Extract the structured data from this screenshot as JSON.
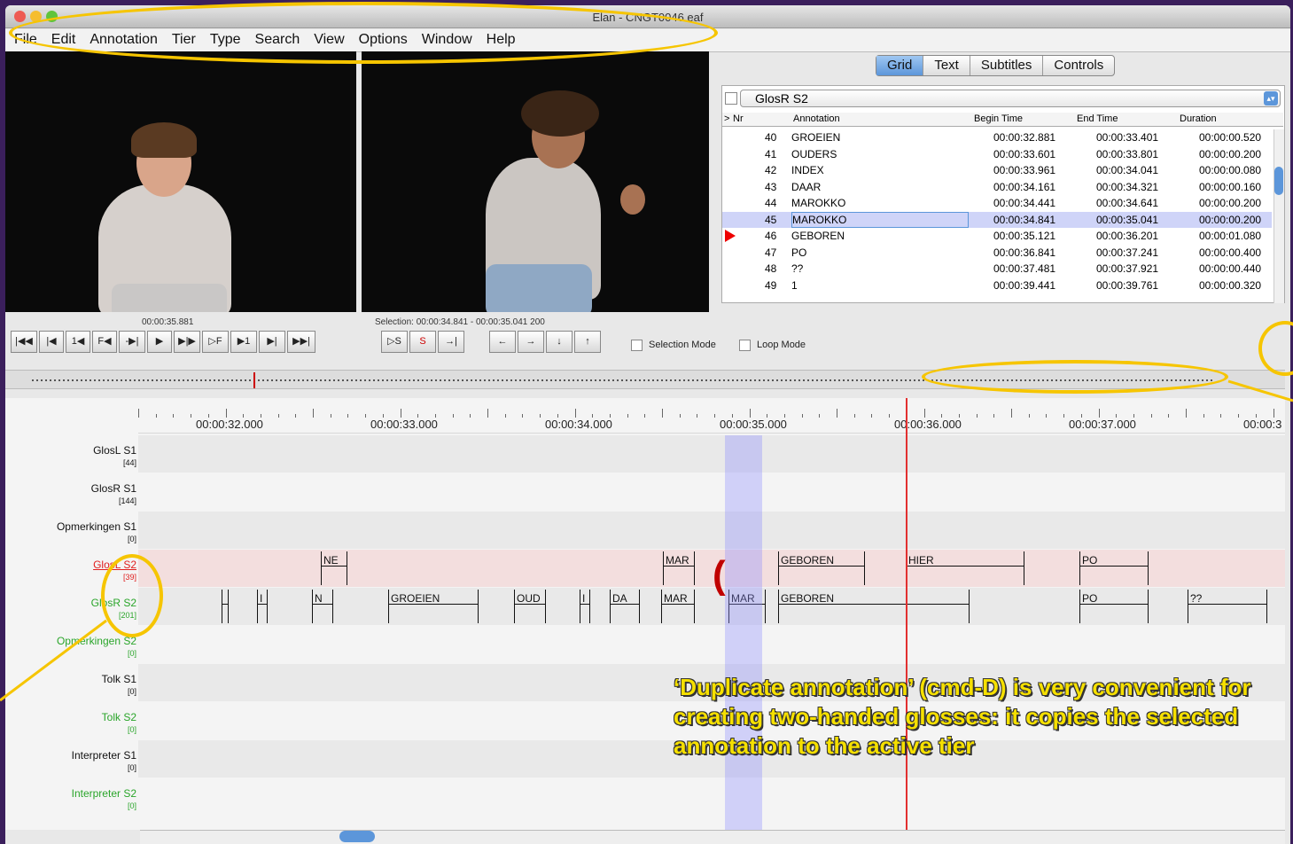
{
  "window": {
    "title": "Elan - CNGT0046.eaf"
  },
  "menu": [
    "File",
    "Edit",
    "Annotation",
    "Tier",
    "Type",
    "Search",
    "View",
    "Options",
    "Window",
    "Help"
  ],
  "media": {
    "time": "00:00:35.881",
    "selection": "Selection: 00:00:34.841 - 00:00:35.041  200"
  },
  "player_buttons": [
    "|◀◀",
    "|◀",
    "1◀",
    "F◀",
    "-▶|",
    "▶",
    "▶|▶",
    "▷F",
    "▶1",
    "▶|",
    "▶▶|"
  ],
  "selection_buttons": [
    "▷S",
    "S",
    "→|"
  ],
  "arrow_buttons": [
    "←",
    "→",
    "↓",
    "↑"
  ],
  "selection_mode": "Selection Mode",
  "loop_mode": "Loop Mode",
  "tabs": [
    "Grid",
    "Text",
    "Subtitles",
    "Controls"
  ],
  "tier_select": "GlosR S2",
  "grid_headers": {
    "pointer": ">",
    "nr": "Nr",
    "annotation": "Annotation",
    "begin": "Begin Time",
    "end": "End Time",
    "duration": "Duration"
  },
  "grid_rows": [
    {
      "nr": "40",
      "annotation": "GROEIEN",
      "begin": "00:00:32.881",
      "end": "00:00:33.401",
      "duration": "00:00:00.520"
    },
    {
      "nr": "41",
      "annotation": "OUDERS",
      "begin": "00:00:33.601",
      "end": "00:00:33.801",
      "duration": "00:00:00.200"
    },
    {
      "nr": "42",
      "annotation": "INDEX",
      "begin": "00:00:33.961",
      "end": "00:00:34.041",
      "duration": "00:00:00.080"
    },
    {
      "nr": "43",
      "annotation": "DAAR",
      "begin": "00:00:34.161",
      "end": "00:00:34.321",
      "duration": "00:00:00.160"
    },
    {
      "nr": "44",
      "annotation": "MAROKKO",
      "begin": "00:00:34.441",
      "end": "00:00:34.641",
      "duration": "00:00:00.200"
    },
    {
      "nr": "45",
      "annotation": "MAROKKO",
      "begin": "00:00:34.841",
      "end": "00:00:35.041",
      "duration": "00:00:00.200"
    },
    {
      "nr": "46",
      "annotation": "GEBOREN",
      "begin": "00:00:35.121",
      "end": "00:00:36.201",
      "duration": "00:00:01.080"
    },
    {
      "nr": "47",
      "annotation": "PO",
      "begin": "00:00:36.841",
      "end": "00:00:37.241",
      "duration": "00:00:00.400"
    },
    {
      "nr": "48",
      "annotation": "??",
      "begin": "00:00:37.481",
      "end": "00:00:37.921",
      "duration": "00:00:00.440"
    },
    {
      "nr": "49",
      "annotation": "1",
      "begin": "00:00:39.441",
      "end": "00:00:39.761",
      "duration": "00:00:00.320"
    }
  ],
  "ruler_labels": [
    "00:00:32.000",
    "00:00:33.000",
    "00:00:34.000",
    "00:00:35.000",
    "00:00:36.000",
    "00:00:37.000",
    "00:00:3"
  ],
  "tiers": [
    {
      "name": "GlosL S1",
      "count": "[44]",
      "color": "#111111"
    },
    {
      "name": "GlosR S1",
      "count": "[144]",
      "color": "#111111"
    },
    {
      "name": "Opmerkingen S1",
      "count": "[0]",
      "color": "#111111"
    },
    {
      "name": "GlosL S2",
      "count": "[39]",
      "color": "#e02020"
    },
    {
      "name": "GlosR S2",
      "count": "[201]",
      "color": "#2aa52a"
    },
    {
      "name": "Opmerkingen S2",
      "count": "[0]",
      "color": "#2aa52a"
    },
    {
      "name": "Tolk S1",
      "count": "[0]",
      "color": "#111111"
    },
    {
      "name": "Tolk S2",
      "count": "[0]",
      "color": "#2aa52a"
    },
    {
      "name": "Interpreter S1",
      "count": "[0]",
      "color": "#111111"
    },
    {
      "name": "Interpreter S2",
      "count": "[0]",
      "color": "#2aa52a"
    }
  ],
  "glosl_s2_annotations": [
    "NE",
    "MAR",
    "GEBOREN",
    "HIER",
    "PO"
  ],
  "glosr_s2_annotations": [
    "",
    "I",
    "N",
    "GROEIEN",
    "OUD",
    "I",
    "DA",
    "MAR",
    "MAR",
    "GEBOREN",
    "PO",
    "??"
  ],
  "callout": "‘Duplicate annotation’ (cmd-D) is very convenient for creating two-handed glosses: it copies the selected annotation to the active tier",
  "paren": "(",
  "colors": {
    "highlight": "#f6c500",
    "accent": "#5c96da",
    "cursor": "#e23030"
  }
}
